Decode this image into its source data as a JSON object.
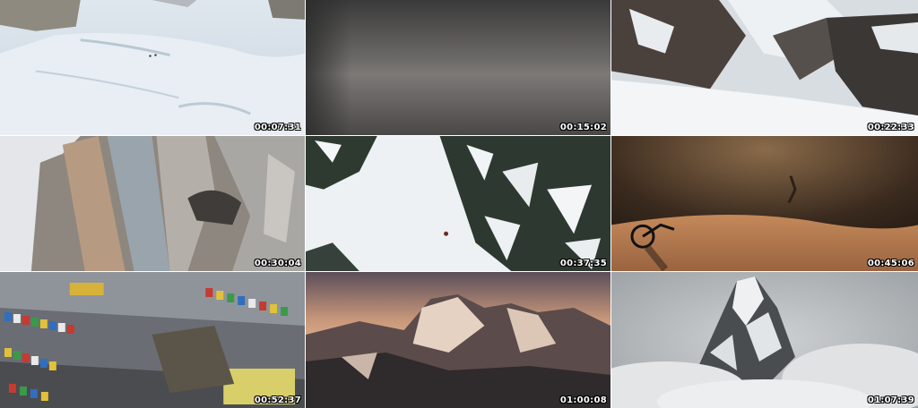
{
  "thumbnails": [
    {
      "timestamp": "00:07:31",
      "scene": "glacier-climbers"
    },
    {
      "timestamp": "00:15:02",
      "scene": "blurred-gray"
    },
    {
      "timestamp": "00:22:33",
      "scene": "snowy-valley-peaks"
    },
    {
      "timestamp": "00:30:04",
      "scene": "granite-cliff"
    },
    {
      "timestamp": "00:37:35",
      "scene": "skier-in-forest"
    },
    {
      "timestamp": "00:45:06",
      "scene": "mountain-biker-dusk"
    },
    {
      "timestamp": "00:52:37",
      "scene": "prayer-flags-camp"
    },
    {
      "timestamp": "01:00:08",
      "scene": "sunset-mountains"
    },
    {
      "timestamp": "01:07:39",
      "scene": "peak-in-clouds"
    }
  ]
}
